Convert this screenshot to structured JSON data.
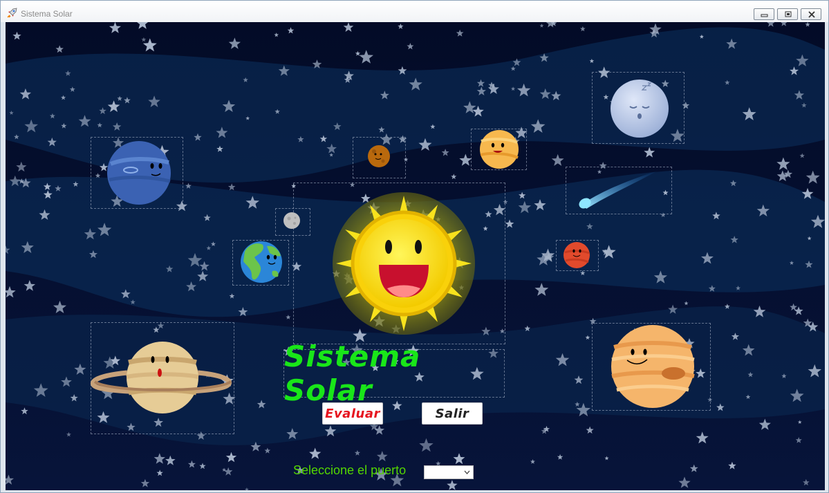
{
  "window": {
    "title": "Sistema Solar"
  },
  "main": {
    "title": "Sistema Solar",
    "title_color": "#19e619",
    "evaluate_label": "Evaluar",
    "evaluate_color": "#e6141e",
    "exit_label": "Salir",
    "exit_color": "#222222"
  },
  "port": {
    "label": "Seleccione el puerto",
    "label_color": "#54d600",
    "selected": ""
  },
  "icons": [
    "rocket-icon",
    "minimize-icon",
    "maximize-icon",
    "close-icon",
    "chevron-down-icon"
  ],
  "planets": [
    "sun",
    "mercury",
    "venus",
    "earth",
    "moon",
    "mars",
    "jupiter",
    "saturn",
    "uranus",
    "neptune",
    "comet"
  ]
}
